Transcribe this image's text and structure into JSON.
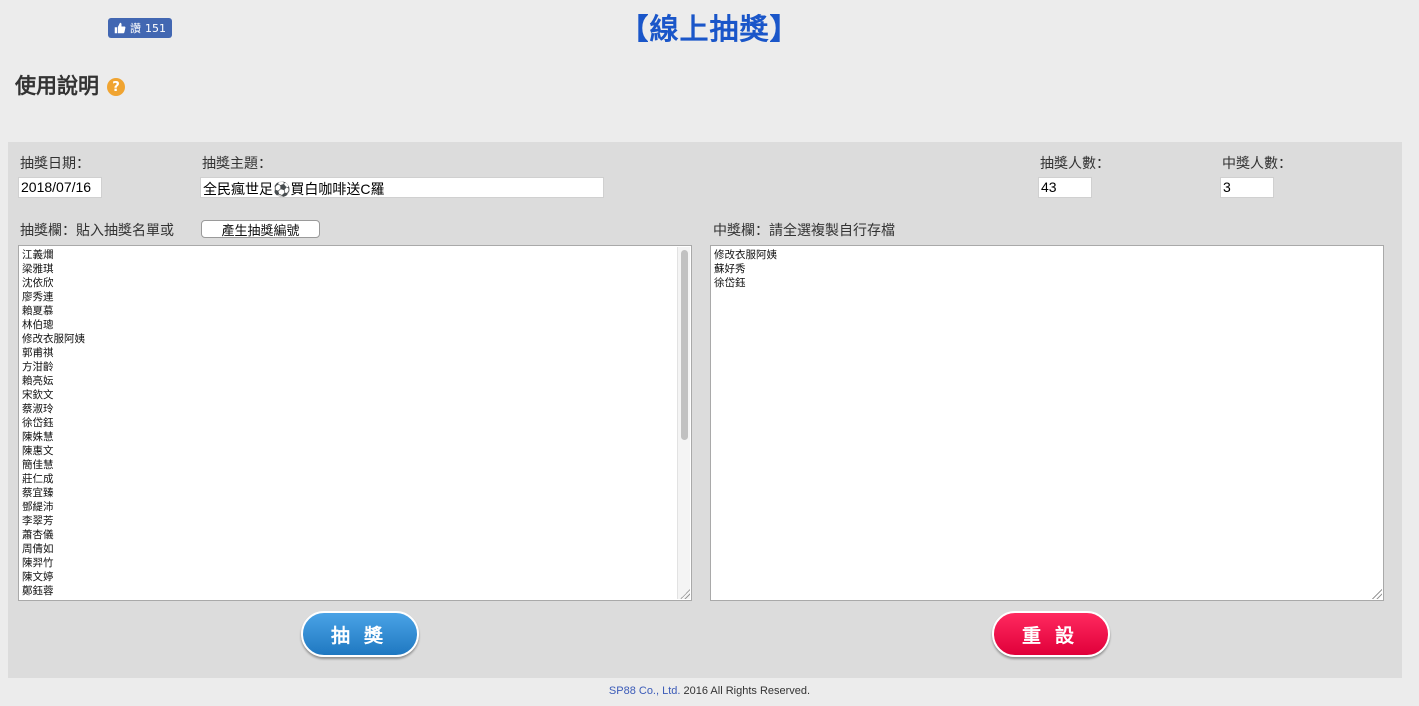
{
  "header": {
    "like_label": "讚",
    "like_count": "151",
    "title": "【線上抽獎】",
    "help_heading": "使用說明",
    "help_icon": "?"
  },
  "form": {
    "date_label": "抽獎日期：",
    "date_value": "2018/07/16",
    "topic_label": "抽獎主題：",
    "topic_value": "全民瘋世足⚽買白咖啡送C羅",
    "participants_label": "抽獎人數：",
    "participants_value": "43",
    "winners_label": "中獎人數：",
    "winners_value": "3",
    "entry_list_label": "抽獎欄：貼入抽獎名單或",
    "generate_button": "產生抽獎編號",
    "winner_list_label": "中獎欄：請全選複製自行存檔"
  },
  "entries": [
    "江義爛",
    "梁雅琪",
    "沈依欣",
    "廖秀連",
    "賴夏慕",
    "林伯璁",
    "修改衣服阿姨",
    "郭甫祺",
    "方泔齡",
    "賴亮妘",
    "宋欽文",
    "蔡淑玲",
    "徐岱鈺",
    "陳姝慧",
    "陳惠文",
    "簡佳慧",
    "莊仁成",
    "蔡宜臻",
    "鄧緹沛",
    "李翠芳",
    "蕭杏儀",
    "周倩如",
    "陳羿竹",
    "陳文婷",
    "鄭鈺蓉"
  ],
  "winners": [
    "修改衣服阿姨",
    "蘇好秀",
    "徐岱鈺"
  ],
  "buttons": {
    "draw": "抽獎",
    "reset": "重設"
  },
  "footer": {
    "brand": "SP88 Co., Ltd.",
    "rest": " 2016 All Rights Reserved."
  },
  "colors": {
    "title": "#1a56c9",
    "draw_button": "#2a88d0",
    "reset_button": "#f5114a",
    "help_icon": "#f0a431",
    "facebook": "#4267b2"
  }
}
